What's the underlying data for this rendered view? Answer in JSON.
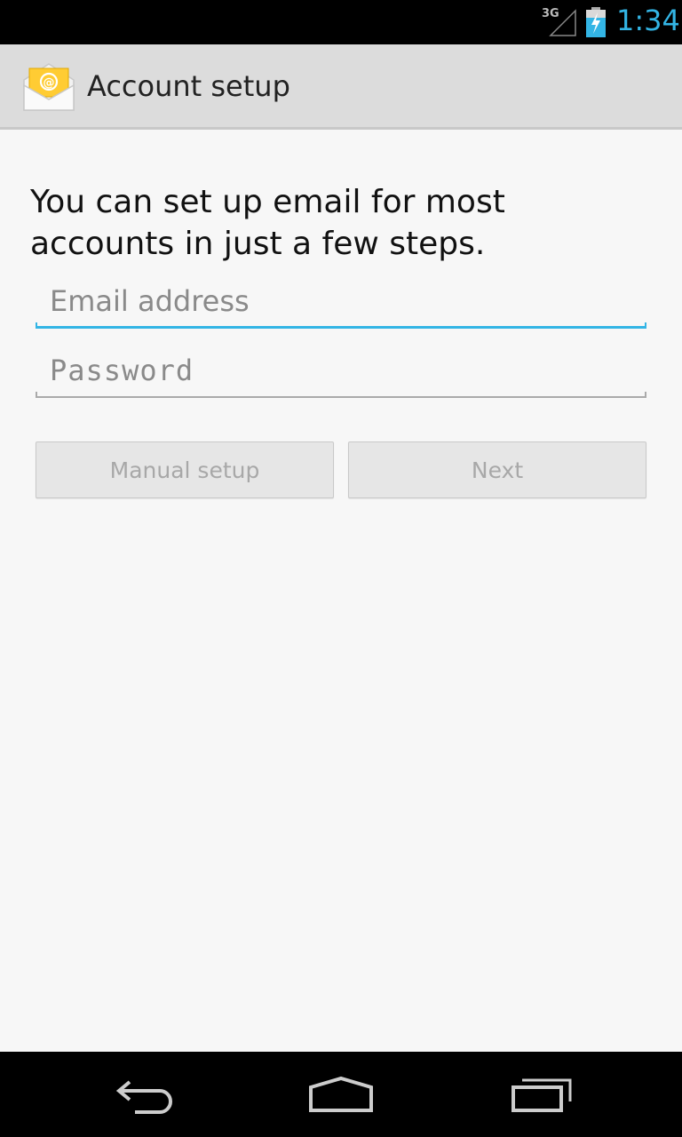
{
  "status_bar": {
    "network_type": "3G",
    "time": "1:34",
    "clock_color": "#33b5e5",
    "icons": [
      "signal-icon",
      "battery-charging-icon"
    ]
  },
  "action_bar": {
    "title": "Account setup",
    "icon": "email-app-icon"
  },
  "form": {
    "intro": "You can set up email for most accounts in just a few steps.",
    "email_placeholder": "Email address",
    "email_value": "",
    "password_placeholder": "Password",
    "password_value": ""
  },
  "buttons": {
    "manual_setup": "Manual setup",
    "next": "Next"
  },
  "nav_bar": {
    "icons": [
      "back-icon",
      "home-icon",
      "recent-apps-icon"
    ]
  },
  "colors": {
    "accent": "#33b5e5",
    "action_bar_bg": "#dcdcdc",
    "background": "#f7f7f7",
    "disabled_text": "#a8a8a8"
  }
}
